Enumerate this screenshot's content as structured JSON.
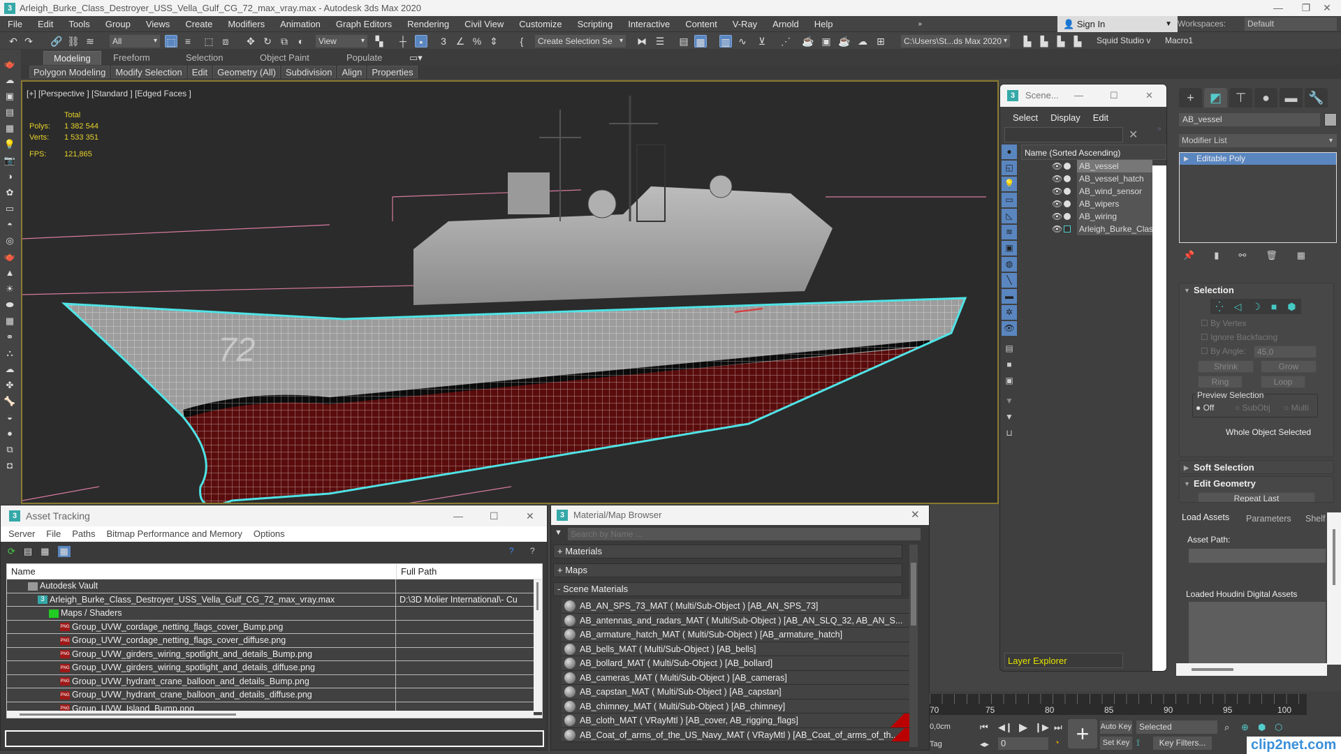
{
  "window": {
    "title": "Arleigh_Burke_Class_Destroyer_USS_Vella_Gulf_CG_72_max_vray.max - Autodesk 3ds Max 2020",
    "logo": "3",
    "minimize": "—",
    "maximize": "❐",
    "close": "✕"
  },
  "menubar": {
    "items": [
      "File",
      "Edit",
      "Tools",
      "Group",
      "Views",
      "Create",
      "Modifiers",
      "Animation",
      "Graph Editors",
      "Rendering",
      "Civil View",
      "Customize",
      "Scripting",
      "Interactive",
      "Content",
      "V-Ray",
      "Arnold",
      "Help"
    ],
    "overflow": "»",
    "signin": "Sign In",
    "workspaces_label": "Workspaces:",
    "workspaces_value": "Default"
  },
  "toolbar": {
    "selection_filter": "All",
    "ref_coord": "View",
    "named_selection": "Create Selection Se",
    "project_path": "C:\\Users\\St...ds Max 2020",
    "squid": "Squid Studio v",
    "macro": "Macro1"
  },
  "ribbon": {
    "tabs": [
      "Modeling",
      "Freeform",
      "Selection",
      "Object Paint",
      "Populate"
    ],
    "active_tab": "Modeling",
    "panels": [
      "Polygon Modeling",
      "Modify Selection",
      "Edit",
      "Geometry (All)",
      "Subdivision",
      "Align",
      "Properties"
    ]
  },
  "viewport": {
    "label": "[+] [Perspective ] [Standard ] [Edged Faces ]",
    "stats": {
      "total_label": "Total",
      "polys_label": "Polys:",
      "polys": "1 382 544",
      "verts_label": "Verts:",
      "verts": "1 533 351",
      "fps_label": "FPS:",
      "fps": "121,865"
    },
    "hull_number": "72",
    "colors": {
      "selection": "#4fe3e6",
      "hull_top": "#9a9a9a",
      "hull_bottom": "#5a0c0c",
      "wire": "#ffffff",
      "helper": "#d77aa0"
    }
  },
  "scene_explorer": {
    "title": "Scene...",
    "menu": [
      "Select",
      "Display",
      "Edit"
    ],
    "column_header": "Name (Sorted Ascending)",
    "rows": [
      {
        "name": "AB_vessel",
        "selected": true
      },
      {
        "name": "AB_vessel_hatch",
        "selected": false
      },
      {
        "name": "AB_wind_sensor",
        "selected": false
      },
      {
        "name": "AB_wipers",
        "selected": false
      },
      {
        "name": "AB_wiring",
        "selected": false
      },
      {
        "name": "Arleigh_Burke_Class",
        "selected": false
      }
    ],
    "layer_explorer": "Layer Explorer"
  },
  "command_panel": {
    "object_name": "AB_vessel",
    "modifier_list": "Modifier List",
    "stack": [
      "Editable Poly"
    ],
    "selection": {
      "title": "Selection",
      "by_vertex": "By Vertex",
      "ignore_backfacing": "Ignore Backfacing",
      "by_angle": "By Angle:",
      "angle_value": "45,0",
      "shrink": "Shrink",
      "grow": "Grow",
      "ring": "Ring",
      "loop": "Loop",
      "preview_selection": "Preview Selection",
      "preview_options": [
        "Off",
        "SubObj",
        "Multi"
      ],
      "preview_selected": "Off",
      "status": "Whole Object Selected"
    },
    "soft_selection": "Soft Selection",
    "edit_geometry": "Edit Geometry",
    "repeat_last": "Repeat Last"
  },
  "houdini": {
    "tabs": [
      "Load Assets",
      "Parameters",
      "Shelf"
    ],
    "asset_path_label": "Asset Path:",
    "loaded_label": "Loaded Houdini Digital Assets"
  },
  "asset_tracking": {
    "title": "Asset Tracking",
    "menu": [
      "Server",
      "File",
      "Paths",
      "Bitmap Performance and Memory",
      "Options"
    ],
    "columns": [
      "Name",
      "Full Path"
    ],
    "rows": [
      {
        "name": "Autodesk Vault",
        "path": "",
        "level": 1,
        "icon": "vault"
      },
      {
        "name": "Arleigh_Burke_Class_Destroyer_USS_Vella_Gulf_CG_72_max_vray.max",
        "path": "D:\\3D Molier International\\- Cu",
        "level": 2,
        "icon": "max"
      },
      {
        "name": "Maps / Shaders",
        "path": "",
        "level": 3,
        "icon": "maps"
      },
      {
        "name": "Group_UVW_cordage_netting_flags_cover_Bump.png",
        "path": "",
        "level": 4,
        "icon": "png"
      },
      {
        "name": "Group_UVW_cordage_netting_flags_cover_diffuse.png",
        "path": "",
        "level": 4,
        "icon": "png"
      },
      {
        "name": "Group_UVW_girders_wiring_spotlight_and_details_Bump.png",
        "path": "",
        "level": 4,
        "icon": "png"
      },
      {
        "name": "Group_UVW_girders_wiring_spotlight_and_details_diffuse.png",
        "path": "",
        "level": 4,
        "icon": "png"
      },
      {
        "name": "Group_UVW_hydrant_crane_balloon_and_details_Bump.png",
        "path": "",
        "level": 4,
        "icon": "png"
      },
      {
        "name": "Group_UVW_hydrant_crane_balloon_and_details_diffuse.png",
        "path": "",
        "level": 4,
        "icon": "png"
      },
      {
        "name": "Group_UVW_Island_Bump.png",
        "path": "",
        "level": 4,
        "icon": "png"
      }
    ]
  },
  "material_browser": {
    "title": "Material/Map Browser",
    "search_placeholder": "Search by Name ...",
    "groups": [
      "+ Materials",
      "+ Maps",
      "- Scene Materials"
    ],
    "materials": [
      {
        "label": "AB_AN_SPS_73_MAT ( Multi/Sub-Object ) [AB_AN_SPS_73]",
        "flag": false
      },
      {
        "label": "AB_antennas_and_radars_MAT ( Multi/Sub-Object ) [AB_AN_SLQ_32, AB_AN_S...",
        "flag": false
      },
      {
        "label": "AB_armature_hatch_MAT ( Multi/Sub-Object ) [AB_armature_hatch]",
        "flag": false
      },
      {
        "label": "AB_bells_MAT ( Multi/Sub-Object ) [AB_bells]",
        "flag": false
      },
      {
        "label": "AB_bollard_MAT ( Multi/Sub-Object ) [AB_bollard]",
        "flag": false
      },
      {
        "label": "AB_cameras_MAT ( Multi/Sub-Object ) [AB_cameras]",
        "flag": false
      },
      {
        "label": "AB_capstan_MAT ( Multi/Sub-Object ) [AB_capstan]",
        "flag": false
      },
      {
        "label": "AB_chimney_MAT ( Multi/Sub-Object ) [AB_chimney]",
        "flag": false
      },
      {
        "label": "AB_cloth_MAT ( VRayMtl ) [AB_cover, AB_rigging_flags]",
        "flag": true
      },
      {
        "label": "AB_Coat_of_arms_of_the_US_Navy_MAT ( VRayMtl ) [AB_Coat_of_arms_of_th...",
        "flag": true
      }
    ]
  },
  "timeline": {
    "ticks": [
      "70",
      "75",
      "80",
      "85",
      "90",
      "95",
      "100"
    ],
    "coord_readout": "0,0cm",
    "tag": "Tag",
    "frame": "0",
    "auto_key": "Auto Key",
    "set_key": "Set Key",
    "key_mode": "Selected",
    "key_filters": "Key Filters..."
  },
  "watermark": "clip2net.com"
}
